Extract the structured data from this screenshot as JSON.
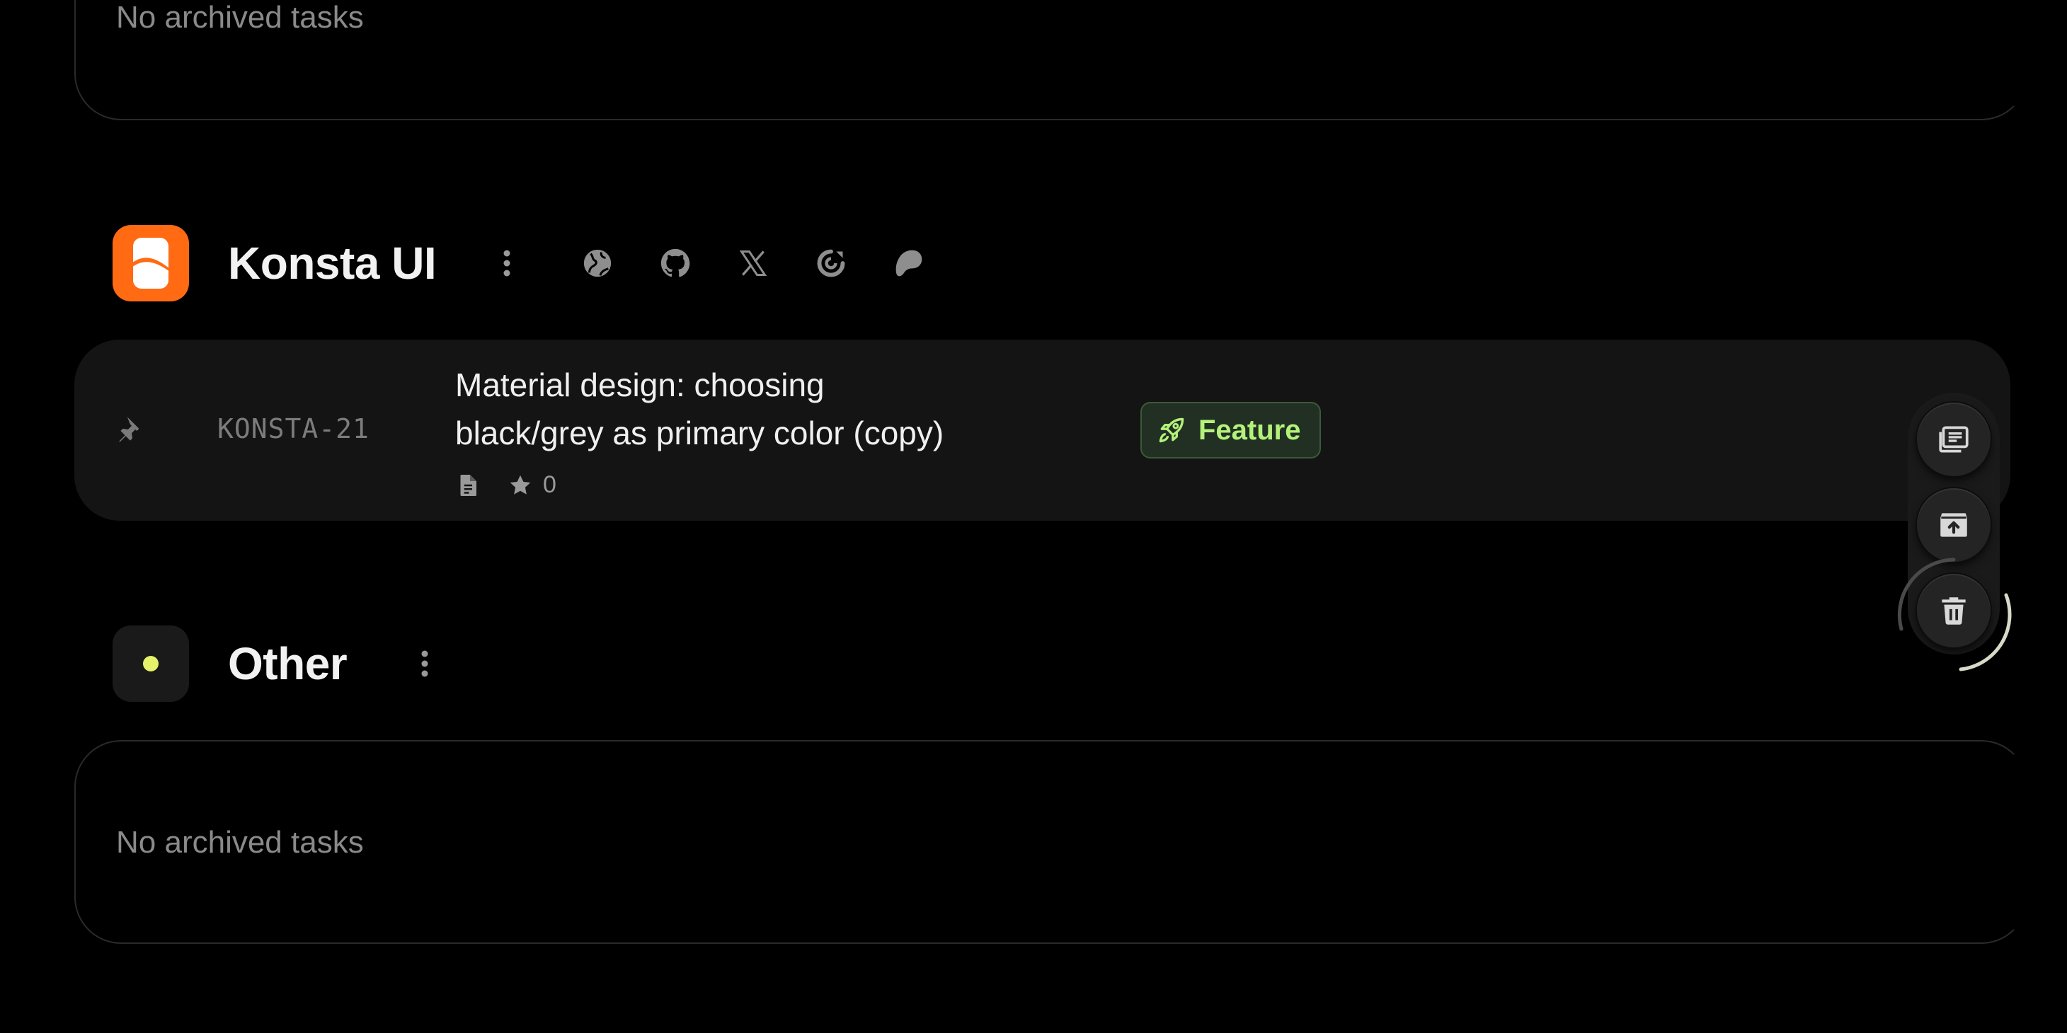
{
  "top_section": {
    "empty_text": "No archived tasks"
  },
  "konsta_project": {
    "name": "Konsta UI",
    "logo_color": "#ff6a13",
    "links": [
      {
        "icon": "globe-icon"
      },
      {
        "icon": "github-icon"
      },
      {
        "icon": "x-icon"
      },
      {
        "icon": "refresh-icon"
      },
      {
        "icon": "patreon-icon"
      }
    ],
    "task": {
      "id": "KONSTA-21",
      "title_line1": "Material design: choosing",
      "title_line2": "black/grey as primary color (copy)",
      "stars": "0",
      "tag": {
        "label": "Feature",
        "color": "#b4f27a",
        "icon": "rocket-icon"
      },
      "pinned": true
    }
  },
  "other_project": {
    "name": "Other",
    "dot_color": "#e6f26a",
    "empty_text": "No archived tasks"
  },
  "actions": [
    {
      "icon": "list-icon",
      "name": "details"
    },
    {
      "icon": "unarchive-icon",
      "name": "unarchive"
    },
    {
      "icon": "trash-icon",
      "name": "delete"
    }
  ],
  "accent_color": "#e6f26a"
}
